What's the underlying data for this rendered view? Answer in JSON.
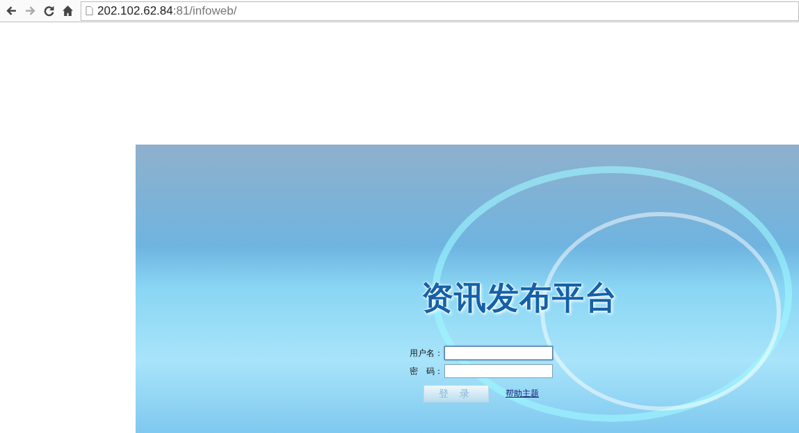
{
  "browser": {
    "url_host": "202.102.62.84",
    "url_rest": ":81/infoweb/"
  },
  "login": {
    "title": "资讯发布平台",
    "username": {
      "label": "用户名：",
      "focused": true
    },
    "password": {
      "label": "密　码："
    },
    "submit": "登 录",
    "help_link": "帮助主题"
  }
}
